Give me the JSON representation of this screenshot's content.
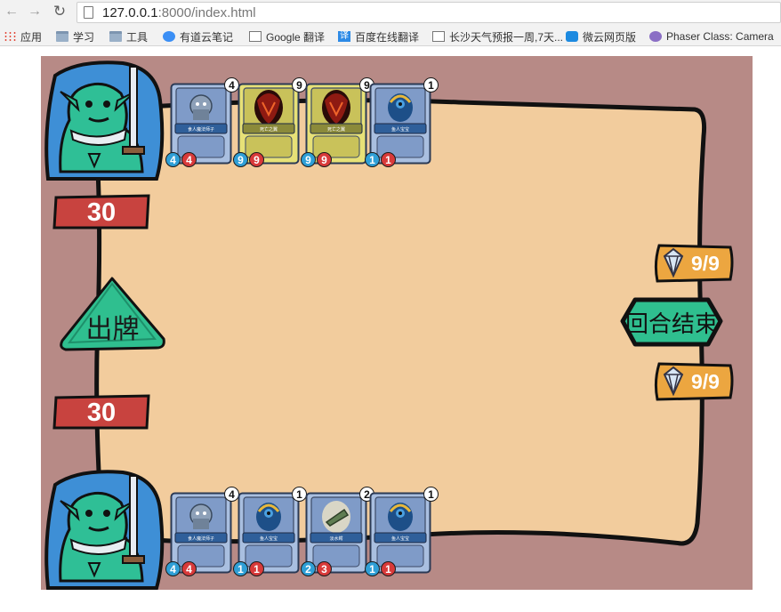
{
  "browser": {
    "url_host": "127.0.0.1",
    "url_path": ":8000/index.html",
    "bookmarks": [
      {
        "label": "应用",
        "icon": "apps-icon"
      },
      {
        "label": "学习",
        "icon": "folder-icon"
      },
      {
        "label": "工具",
        "icon": "folder-icon"
      },
      {
        "label": "有道云笔记",
        "icon": "youdao-note-icon"
      },
      {
        "label": "Google 翻译",
        "icon": "page-icon"
      },
      {
        "label": "百度在线翻译",
        "icon": "fanyi-icon"
      },
      {
        "label": "长沙天气预报一周,7天...",
        "icon": "page-icon"
      },
      {
        "label": "微云网页版",
        "icon": "weiyun-icon"
      },
      {
        "label": "Phaser Class: Camera",
        "icon": "phaser-icon"
      }
    ]
  },
  "game": {
    "enemy": {
      "health": "30",
      "mana": "9/9",
      "cards": [
        {
          "name": "食人魔法师孑",
          "cost": "4",
          "attack": "4",
          "health": "4",
          "art": "ogre",
          "frame": "blue"
        },
        {
          "name": "死亡之翼",
          "cost": "9",
          "attack": "9",
          "health": "9",
          "art": "dragon",
          "frame": "gold"
        },
        {
          "name": "死亡之翼",
          "cost": "9",
          "attack": "9",
          "health": "9",
          "art": "dragon",
          "frame": "gold"
        },
        {
          "name": "鱼人宝宝",
          "cost": "1",
          "attack": "1",
          "health": "1",
          "art": "murloc",
          "frame": "blue"
        }
      ]
    },
    "player": {
      "health": "30",
      "mana": "9/9",
      "cards": [
        {
          "name": "食人魔法师孑",
          "cost": "4",
          "attack": "4",
          "health": "4",
          "art": "ogre",
          "frame": "blue"
        },
        {
          "name": "鱼人宝宝",
          "cost": "1",
          "attack": "1",
          "health": "1",
          "art": "murloc",
          "frame": "blue"
        },
        {
          "name": "淡水鳄",
          "cost": "2",
          "attack": "2",
          "health": "3",
          "art": "croc",
          "frame": "blue"
        },
        {
          "name": "鱼人宝宝",
          "cost": "1",
          "attack": "1",
          "health": "1",
          "art": "murloc",
          "frame": "blue"
        }
      ]
    },
    "play_button_label": "出牌",
    "end_turn_label": "回合结束",
    "colors": {
      "background": "#b78a86",
      "board": "#f2cc9d",
      "hero_bg": "#3e8fd6",
      "hero_skin": "#2fbf96",
      "health_banner": "#c8433f",
      "mana_banner": "#eca640",
      "button_green": "#2fbf8f"
    }
  }
}
